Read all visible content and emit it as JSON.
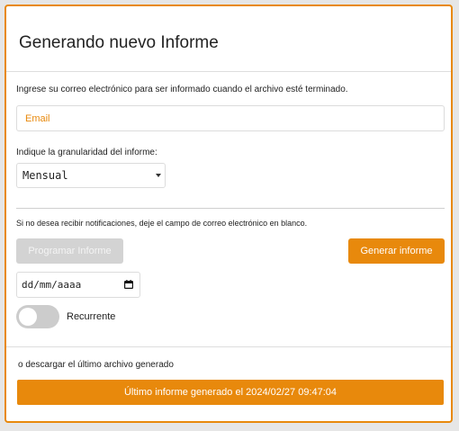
{
  "modal": {
    "title": "Generando nuevo Informe"
  },
  "email": {
    "help": "Ingrese su correo electrónico para ser informado cuando el archivo esté terminado.",
    "placeholder": "Email",
    "value": ""
  },
  "granularity": {
    "label": "Indique la granularidad del informe:",
    "selected": "Mensual"
  },
  "notify_text": "Si no desea recibir notificaciones, deje el campo de correo electrónico en blanco.",
  "buttons": {
    "schedule": "Programar Informe",
    "generate": "Generar informe"
  },
  "date": {
    "placeholder": "dd/mm/aaaa"
  },
  "recurring": {
    "label": "Recurrente",
    "enabled": false
  },
  "download": {
    "text": "o descargar el último archivo generado",
    "button": "Último informe generado el 2024/02/27 09:47:04"
  },
  "colors": {
    "accent": "#e8890c",
    "disabled": "#d3d3d3"
  },
  "icons": {
    "date": "calendar-icon",
    "select": "chevron-down-icon"
  }
}
